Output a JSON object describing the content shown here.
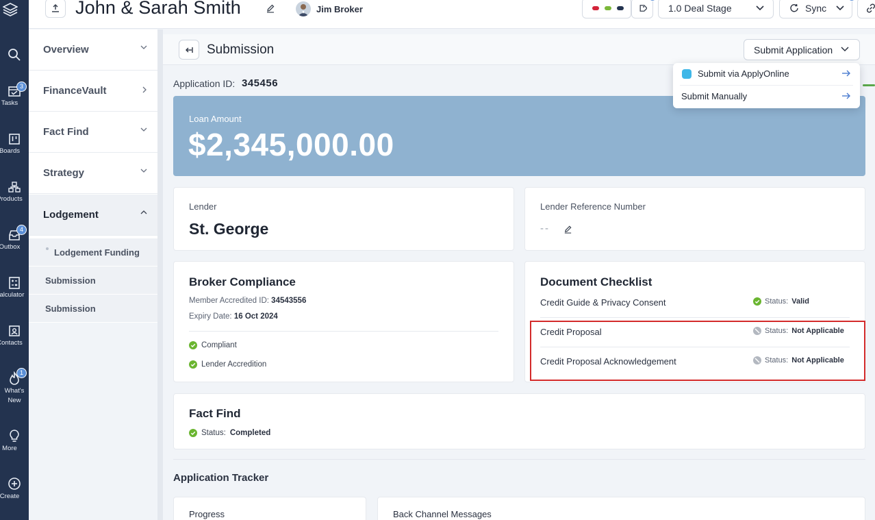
{
  "header": {
    "client_name": "John & Sarah Smith",
    "broker_name": "Jim Broker",
    "deal_stage": "1.0 Deal Stage",
    "sync_label": "Sync",
    "status_dot_colors": [
      "#d3243a",
      "#7bb83a",
      "#23334f"
    ]
  },
  "rail": {
    "items": [
      {
        "icon": "search-icon",
        "label": ""
      },
      {
        "icon": "tasks-icon",
        "label": "Tasks",
        "badge": "3"
      },
      {
        "icon": "boards-icon",
        "label": "Boards"
      },
      {
        "icon": "products-icon",
        "label": "Products"
      },
      {
        "icon": "outbox-icon",
        "label": "Outbox",
        "badge": "4"
      },
      {
        "icon": "calculator-icon",
        "label": "Calculator"
      },
      {
        "icon": "contacts-icon",
        "label": "Contacts"
      },
      {
        "icon": "whats-new-icon",
        "label": "What's New",
        "badge": "1"
      },
      {
        "icon": "more-icon",
        "label": "More"
      },
      {
        "icon": "create-icon",
        "label": "Create"
      }
    ]
  },
  "subnav": {
    "sections": [
      "Overview",
      "FinanceVault",
      "Fact Find",
      "Strategy",
      "Lodgement"
    ],
    "sub_items": [
      "Lodgement Funding",
      "Submission",
      "Submission"
    ]
  },
  "main": {
    "title": "Submission",
    "submit_button": "Submit Application",
    "application_id_label": "Application ID:",
    "application_id": "345456",
    "loan_amount_label": "Loan Amount",
    "loan_amount": "$2,345,000.00",
    "lender_label": "Lender",
    "lender": "St. George",
    "lender_ref_label": "Lender Reference Number",
    "lender_ref_value": "--",
    "broker_compliance": {
      "title": "Broker Compliance",
      "member_id_label": "Member Accredited ID:",
      "member_id": "34543556",
      "expiry_label": "Expiry Date:",
      "expiry": "16 Oct 2024",
      "checks": [
        "Compliant",
        "Lender Accredition"
      ]
    },
    "document_checklist": {
      "title": "Document Checklist",
      "status_label": "Status:",
      "items": [
        {
          "name": "Credit Guide & Privacy Consent",
          "status": "Valid"
        },
        {
          "name": "Credit Proposal",
          "status": "Not Applicable"
        },
        {
          "name": "Credit Proposal Acknowledgement",
          "status": "Not Applicable"
        }
      ]
    },
    "fact_find": {
      "title": "Fact Find",
      "status_label": "Status:",
      "status": "Completed"
    },
    "tracker": {
      "title": "Application Tracker",
      "progress": "Progress",
      "back_channel": "Back Channel Messages"
    }
  },
  "dropdown": {
    "items": [
      "Submit via ApplyOnline",
      "Submit Manually"
    ]
  },
  "colors": {
    "rail_bg": "#23334f",
    "loan_card": "#8fb2d0",
    "valid_green": "#6ab530",
    "highlight_red": "#d32a2a"
  }
}
